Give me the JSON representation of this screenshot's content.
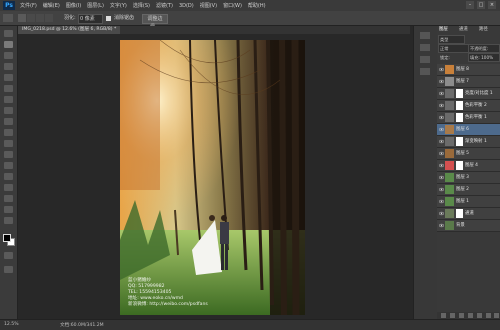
{
  "app": {
    "logo": "Ps"
  },
  "menu": [
    "文件(F)",
    "编辑(E)",
    "图像(I)",
    "图层(L)",
    "文字(Y)",
    "选择(S)",
    "滤镜(T)",
    "3D(D)",
    "视图(V)",
    "窗口(W)",
    "帮助(H)"
  ],
  "window_controls": [
    "–",
    "□",
    "×"
  ],
  "options_bar": {
    "feather_label": "羽化:",
    "feather_value": "0 像素",
    "antialias_label": "消除锯齿",
    "refine_edge_button": "调整边缘..."
  },
  "document_tab": "IMG_0218.psd @ 12.6% (图层 6, RGB/8) *",
  "status": {
    "zoom": "12.5%",
    "doc_size": "文档:60.0M/341.2M"
  },
  "layers_panel": {
    "tabs": [
      "图层",
      "通道",
      "路径"
    ],
    "kind_label": "类型",
    "blend_mode": "正常",
    "opacity": "不透明度: 100%",
    "lock_label": "锁定:",
    "fill": "填充: 100%",
    "layers": [
      {
        "name": "图层 8",
        "color": "#c8803a",
        "mask": false,
        "selected": false
      },
      {
        "name": "图层 7",
        "color": "#8c8c8c",
        "mask": false,
        "selected": false
      },
      {
        "name": "亮度/对比度 1",
        "color": "#6b6b6b",
        "mask": true,
        "selected": false
      },
      {
        "name": "色彩平衡 2",
        "color": "#6b6b6b",
        "mask": true,
        "selected": false
      },
      {
        "name": "色彩平衡 1",
        "color": "#6b6b6b",
        "mask": true,
        "selected": false
      },
      {
        "name": "图层 6",
        "color": "#a87a4a",
        "mask": false,
        "selected": true
      },
      {
        "name": "渐变映射 1",
        "color": "#6b6b6b",
        "mask": true,
        "selected": false
      },
      {
        "name": "图层 5",
        "color": "#9a6a3a",
        "mask": false,
        "selected": false
      },
      {
        "name": "图层 4",
        "color": "#d45050",
        "mask": true,
        "selected": false
      },
      {
        "name": "图层 3",
        "color": "#5a8a4a",
        "mask": false,
        "selected": false
      },
      {
        "name": "图层 2",
        "color": "#5a8a4a",
        "mask": false,
        "selected": false
      },
      {
        "name": "图层 1",
        "color": "#5a8a4a",
        "mask": false,
        "selected": false
      },
      {
        "name": "通道",
        "color": "#6a7a5a",
        "mask": true,
        "selected": false
      },
      {
        "name": "背景",
        "color": "#5a7a4a",
        "mask": false,
        "selected": false
      }
    ]
  },
  "photo_watermark": [
    "蓝小猪婚纱",
    "QQ: 517999982",
    "TEL: 15594153405",
    "地址: www.eoko.cn/wmd",
    "新浪微博: http://weibo.com/psdfans"
  ]
}
